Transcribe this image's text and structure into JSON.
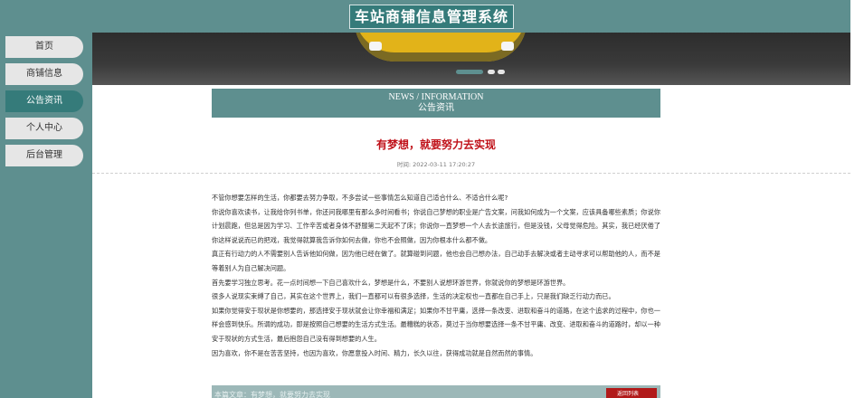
{
  "app": {
    "title": "车站商铺信息管理系统"
  },
  "sidebar": {
    "items": [
      {
        "label": "首页",
        "active": false
      },
      {
        "label": "商铺信息",
        "active": false
      },
      {
        "label": "公告资讯",
        "active": true
      },
      {
        "label": "个人中心",
        "active": false
      },
      {
        "label": "后台管理",
        "active": false
      }
    ]
  },
  "banner": {
    "slide_count": 3,
    "active_slide": 1
  },
  "section": {
    "title_en": "NEWS / INFORMATION",
    "title_cn": "公告资讯"
  },
  "article": {
    "title": "有梦想，就要努力去实现",
    "time": "时间: 2022-03-11 17:20:27",
    "paragraphs": [
      "不管你想要怎样的生活，你都要去努力争取，不多尝试一些事情怎么知道自己适合什么、不适合什么呢?",
      "你说你喜欢读书，让我给你列书单，你还问我哪里有那么多时间看书；你说自己梦想的职业是广告文案，问我如何成为一个文案，应该具备哪些素质；你说你计划晨跑，但总是因为学习、工作辛苦或者身体不舒服第二天起不了床；你说你一直梦想一个人去长途旅行，但是没钱，父母觉得危险。其实，我已经厌倦了你这样说说而已的把戏，我觉得就算我告诉你如何去做，你也不会照做，因为你根本什么都不做。",
      "真正有行动力的人不需要别人告诉他如何做，因为他已经在做了。就算碰到问题，他也会自己想办法，自己动手去解决或者主动寻求可以帮助他的人，而不是等着别人为自己解决问题。",
      "首先要学习独立思考。花一点时间想一下自己喜欢什么，梦想是什么，不要别人说想环游世界，你就说你的梦想是环游世界。",
      "很多人说现实束缚了自己，其实在这个世界上，我们一直都可以有很多选择，生活的决定权也一直都在自己手上，只是我们缺乏行动力而已。",
      "如果你觉得安于现状是你想要的，那选择安于现状就会让你幸福和满足；如果你不甘平庸，选择一条改变、进取和奋斗的道路，在这个追求的过程中，你也一样会感到快乐。所谓的成功，即是按照自己想要的生活方式生活。最糟糕的状态，莫过于当你想要选择一条不甘平庸、改变、进取和奋斗的道路时，却以一种安于现状的方式生活，最后抱怨自己没有得到想要的人生。",
      "因为喜欢，你不是在苦苦坚持，也因为喜欢，你愿意投入时间、精力，长久以往，获得成功就是自然而然的事情。"
    ]
  },
  "footer_bar": {
    "text": "本篇文章：有梦想，就要努力去实现",
    "button": "返回列表"
  },
  "colors": {
    "primary": "#5e8f8f",
    "dark": "#357b7a",
    "title_red": "#c0121a"
  }
}
